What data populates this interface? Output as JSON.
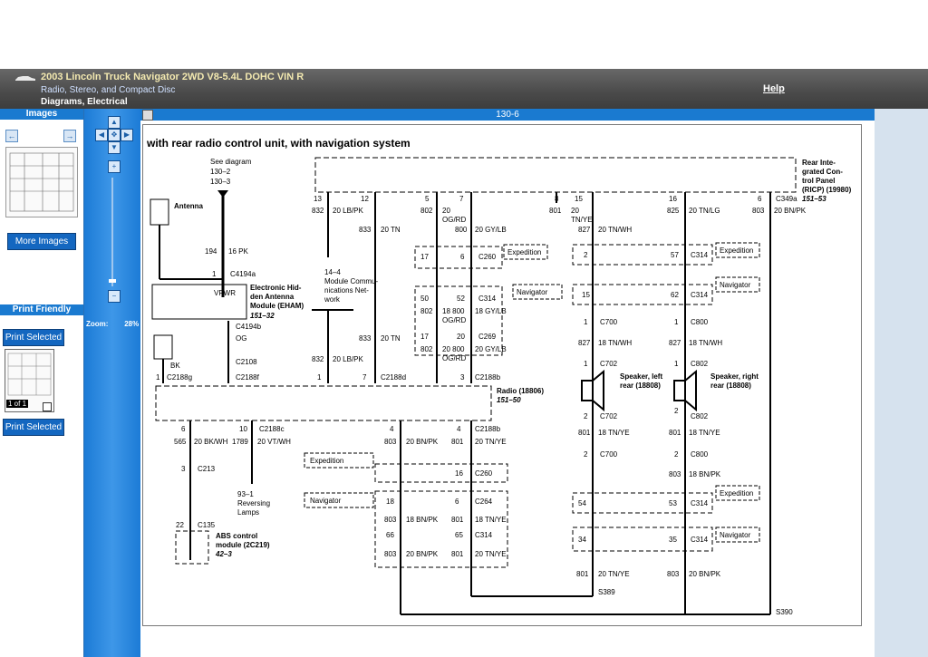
{
  "header": {
    "title": "2003 Lincoln Truck Navigator 2WD V8-5.4L DOHC VIN R",
    "subtitle": "Radio, Stereo, and Compact Disc",
    "category": "Diagrams, Electrical",
    "help": "Help"
  },
  "left": {
    "images_heading": "Images",
    "more_images": "More Images",
    "print_friendly_heading": "Print Friendly",
    "print_selected": "Print Selected",
    "page_count": "1 of 1"
  },
  "zoom": {
    "label": "Zoom:",
    "value": "28%"
  },
  "viewer": {
    "page_number": "130-6"
  },
  "diagram": {
    "title": "with rear radio control unit, with navigation system",
    "see_diagram": [
      "See diagram",
      "130–2",
      "130–3"
    ],
    "antenna": "Antenna",
    "ricp": [
      "Rear Inte-",
      "grated Con-",
      "trol Panel",
      "(RICP) (19980)",
      "151–53"
    ],
    "eham": [
      "Electronic Hid-",
      "den Antenna",
      "Module (EHAM)",
      "151–32"
    ],
    "radio": [
      "Radio (18806)",
      "151–50"
    ],
    "module_net": [
      "14–4",
      "Module Commu-",
      "nications Net-",
      "work"
    ],
    "reversing": [
      "93–1",
      "Reversing",
      "Lamps"
    ],
    "abs": [
      "ABS control",
      "module (2C219)",
      "42–3"
    ],
    "spk_left": [
      "Speaker, left",
      "rear (18808)"
    ],
    "spk_right": [
      "Speaker, right",
      "rear (18808)"
    ],
    "labels": {
      "vpwr": "VPWR",
      "og": "OG",
      "bk": "BK",
      "expedition": "Expedition",
      "navigator": "Navigator",
      "c4194a": "C4194a",
      "c4194b": "C4194b",
      "c2108": "C2108",
      "c2188g": "C2188g",
      "c2188f": "C2188f",
      "c2188d": "C2188d",
      "c2188b": "C2188b",
      "c2188c": "C2188c",
      "c349a": "C349a",
      "c260": "C260",
      "c314": "C314",
      "c269": "C269",
      "c700": "C700",
      "c702": "C702",
      "c800": "C800",
      "c802": "C802",
      "c213": "C213",
      "c135": "C135",
      "c264": "C264",
      "s389": "S389",
      "s390": "S390"
    },
    "wires": {
      "w13": "13",
      "w832": "832",
      "w12": "12",
      "w5": "5",
      "w7": "7",
      "w8": "8",
      "w15": "15",
      "w16": "16",
      "w6": "6",
      "lbpk": "20 LB/PK",
      "tn": "20 TN",
      "tnlg": "20 TN/LG",
      "bnpk": "20 BN/PK",
      "ogrd20": "20",
      "ogrd": "OG/RD",
      "gylb": "20 GY/LB",
      "tnye20": "20",
      "tnye": "TN/YE",
      "tnwh": "20 TN/WH",
      "n802": "802",
      "n801": "801",
      "n825": "825",
      "n803": "803",
      "n833": "833",
      "n800": "800",
      "n827": "827",
      "n194": "194",
      "pk16": "16 PK",
      "n1": "1",
      "n17": "17",
      "n6": "6",
      "n2": "2",
      "n57": "57",
      "n50": "50",
      "n52": "52",
      "n15": "15",
      "n62": "62",
      "gylb18": "18 GY/LB",
      "r800": "18  800",
      "tnwh18": "18 TN/WH",
      "n3": "3",
      "n20": "20",
      "gylb20b": "20 GY/LB",
      "r800b": "20  800",
      "n565": "565",
      "bkwh": "20 BK/WH",
      "n1789": "1789",
      "vtwh": "20 VT/WH",
      "n10": "10",
      "n4": "4",
      "bnpk20": "20 BN/PK",
      "tnye20b": "20 TN/YE",
      "n16": "16",
      "n18": "18",
      "n66": "66",
      "n65": "65",
      "bnpk18": "18 BN/PK",
      "tnye18": "18 TN/YE",
      "n22": "22",
      "tnye18b": "18 TN/YE",
      "n54": "54",
      "n53": "53",
      "n34": "34",
      "n35": "35",
      "bnpk18b": "18 BN/PK",
      "bnpk20b": "20 BN/PK",
      "tnye20c": "20 TN/YE"
    }
  },
  "colors": {
    "header_dark": "#4a4a4a",
    "panel_blue": "#1a7ad0",
    "right_pane": "#d6e2ee"
  }
}
